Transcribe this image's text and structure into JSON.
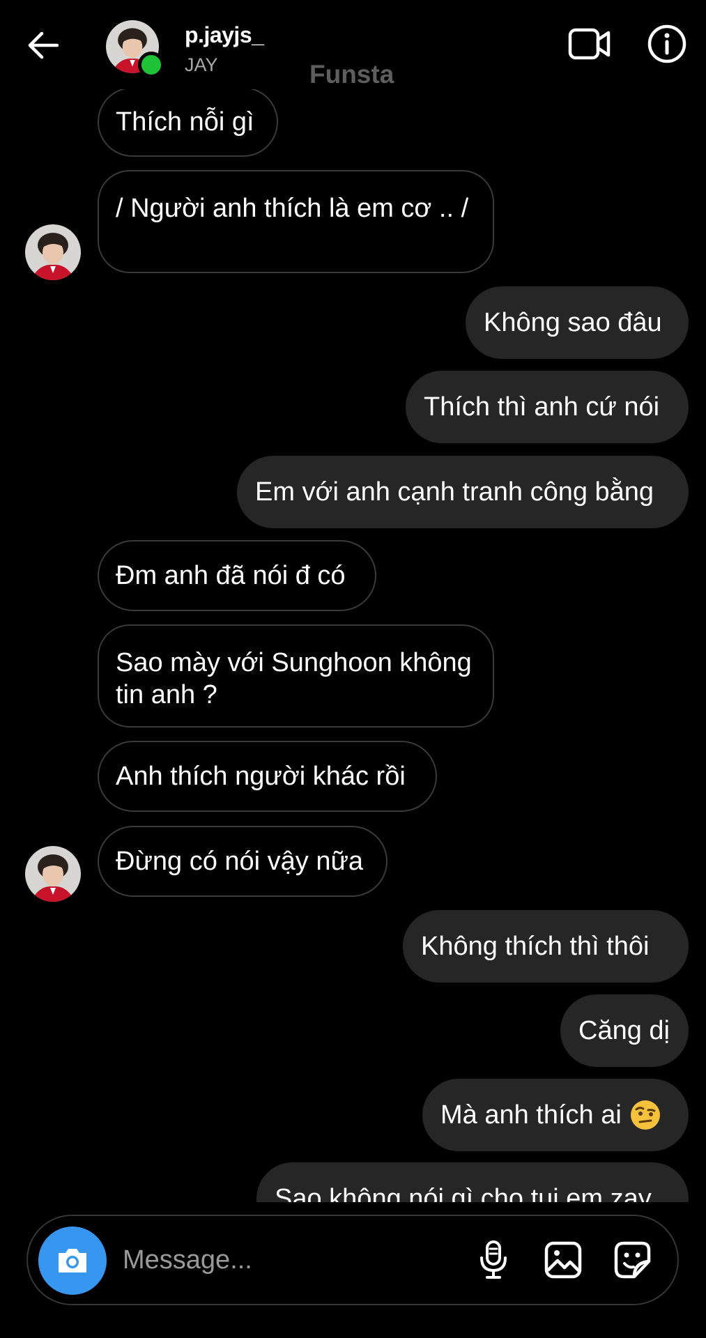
{
  "header": {
    "username": "p.jayjs_",
    "display_name": "JAY",
    "overlay_label": "Funsta"
  },
  "messages": [
    {
      "direction": "incoming",
      "text": "Thích nỗi gì"
    },
    {
      "direction": "incoming",
      "text": "/ Người anh thích là em cơ .. /",
      "avatar": true
    },
    {
      "direction": "outgoing",
      "text": "Không sao đâu"
    },
    {
      "direction": "outgoing",
      "text": "Thích thì anh cứ nói"
    },
    {
      "direction": "outgoing",
      "text": "Em với anh cạnh tranh công bằng"
    },
    {
      "direction": "incoming",
      "text": "Đm anh đã nói đ có"
    },
    {
      "direction": "incoming",
      "text": "Sao mày với Sunghoon không tin anh ?"
    },
    {
      "direction": "incoming",
      "text": "Anh thích người khác rồi"
    },
    {
      "direction": "incoming",
      "text": "Đừng có nói vậy nữa",
      "avatar": true
    },
    {
      "direction": "outgoing",
      "text": "Không thích thì thôi"
    },
    {
      "direction": "outgoing",
      "text": "Căng dị"
    },
    {
      "direction": "outgoing",
      "text": "Mà anh thích ai",
      "emoji": "raised-eyebrow-emoji"
    },
    {
      "direction": "outgoing",
      "text": "Sao không nói gì cho tui em zay"
    }
  ],
  "composer": {
    "placeholder": "Message..."
  },
  "colors": {
    "background": "#000000",
    "outgoing_bubble": "#262626",
    "incoming_border": "#3a3a3a",
    "camera_button": "#3797f0",
    "online_dot": "#1fc337"
  },
  "icons": {
    "back": "arrow-left-icon",
    "video": "video-camera-icon",
    "info": "info-icon",
    "camera": "camera-icon",
    "mic": "microphone-icon",
    "gallery": "image-icon",
    "sticker": "sticker-icon"
  }
}
